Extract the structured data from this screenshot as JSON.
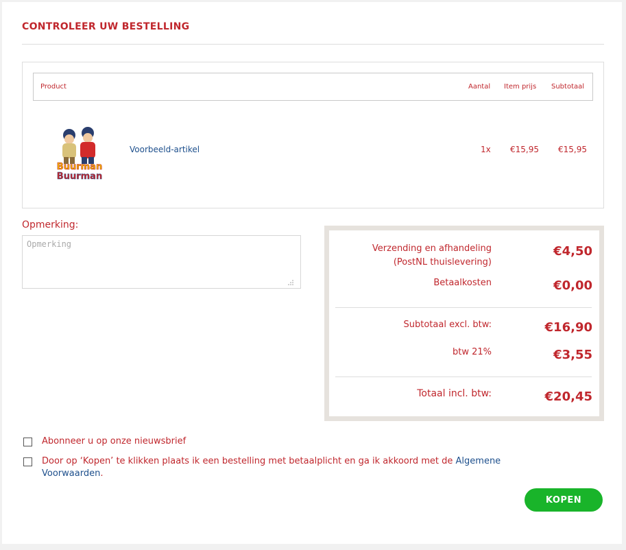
{
  "page": {
    "title": "CONTROLEER UW BESTELLING"
  },
  "cart": {
    "headers": {
      "product": "Product",
      "quantity": "Aantal",
      "item_price": "Item prijs",
      "subtotal": "Subtotaal"
    },
    "items": [
      {
        "name": "Voorbeeld-artikel",
        "quantity": "1x",
        "item_price": "€15,95",
        "subtotal": "€15,95",
        "image": "buurman-buurman-product-image"
      }
    ]
  },
  "remark": {
    "label": "Opmerking:",
    "placeholder": "Opmerking",
    "value": ""
  },
  "totals": {
    "shipping_label": "Verzending en afhandeling",
    "shipping_method": "(PostNL thuislevering)",
    "shipping_value": "€4,50",
    "payment_label": "Betaalkosten",
    "payment_value": "€0,00",
    "subtotal_label": "Subtotaal excl. btw:",
    "subtotal_value": "€16,90",
    "vat_label": "btw 21%",
    "vat_value": "€3,55",
    "total_label": "Totaal incl. btw:",
    "total_value": "€20,45"
  },
  "newsletter": {
    "label": "Abonneer u op onze nieuwsbrief",
    "checked": false
  },
  "terms": {
    "text_before": "Door op ‘Kopen’ te klikken plaats ik een bestelling met betaalplicht en ga ik akkoord met de ",
    "link_text": "Algemene Voorwaarden",
    "text_after": ".",
    "checked": false
  },
  "buy_button": {
    "label": "KOPEN"
  },
  "colors": {
    "accent": "#c0272d",
    "link": "#1d4f8c",
    "button": "#19b42a",
    "totals_border": "#e6e2dd"
  }
}
